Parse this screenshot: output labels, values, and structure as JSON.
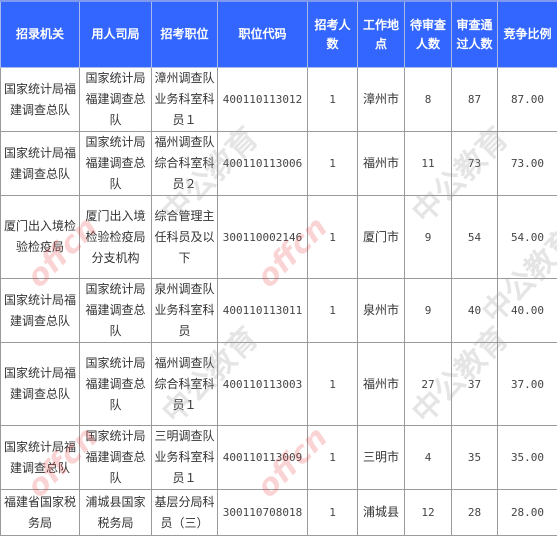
{
  "table": {
    "headers": [
      "招录机关",
      "用人司局",
      "招考职位",
      "职位代码",
      "招考人数",
      "工作地点",
      "待审查人数",
      "审查通过人数",
      "竞争比例"
    ],
    "rows": [
      [
        "国家统计局福建调查总队",
        "国家统计局福建调查总队",
        "漳州调查队业务科室科员１",
        "400110113012",
        "1",
        "漳州市",
        "8",
        "87",
        "87.00"
      ],
      [
        "国家统计局福建调查总队",
        "国家统计局福建调查总队",
        "福州调查队综合科室科员２",
        "400110113006",
        "1",
        "福州市",
        "11",
        "73",
        "73.00"
      ],
      [
        "厦门出入境检验检疫局",
        "厦门出入境检验检疫局分支机构",
        "综合管理主任科员及以下",
        "300110002146",
        "1",
        "厦门市",
        "9",
        "54",
        "54.00"
      ],
      [
        "国家统计局福建调查总队",
        "国家统计局福建调查总队",
        "泉州调查队业务科室科员",
        "400110113011",
        "1",
        "泉州市",
        "9",
        "40",
        "40.00"
      ],
      [
        "国家统计局福建调查总队",
        "国家统计局福建调查总队",
        "福州调查队综合科室科员１",
        "400110113003",
        "1",
        "福州市",
        "27",
        "37",
        "37.00"
      ],
      [
        "国家统计局福建调查总队",
        "国家统计局福建调查总队",
        "三明调查队业务科室科员１",
        "400110113009",
        "1",
        "三明市",
        "4",
        "35",
        "35.00"
      ],
      [
        "福建省国家税务局",
        "浦城县国家税务局",
        "基层分局科员（三）",
        "300110708018",
        "1",
        "浦城县",
        "12",
        "28",
        "28.00"
      ]
    ]
  },
  "watermark": {
    "brand_cn": "中公教育",
    "brand_en": "offcn"
  },
  "colors": {
    "header_bg": "#3366ff",
    "header_text": "#ffffff",
    "border": "#9a9a9a"
  }
}
